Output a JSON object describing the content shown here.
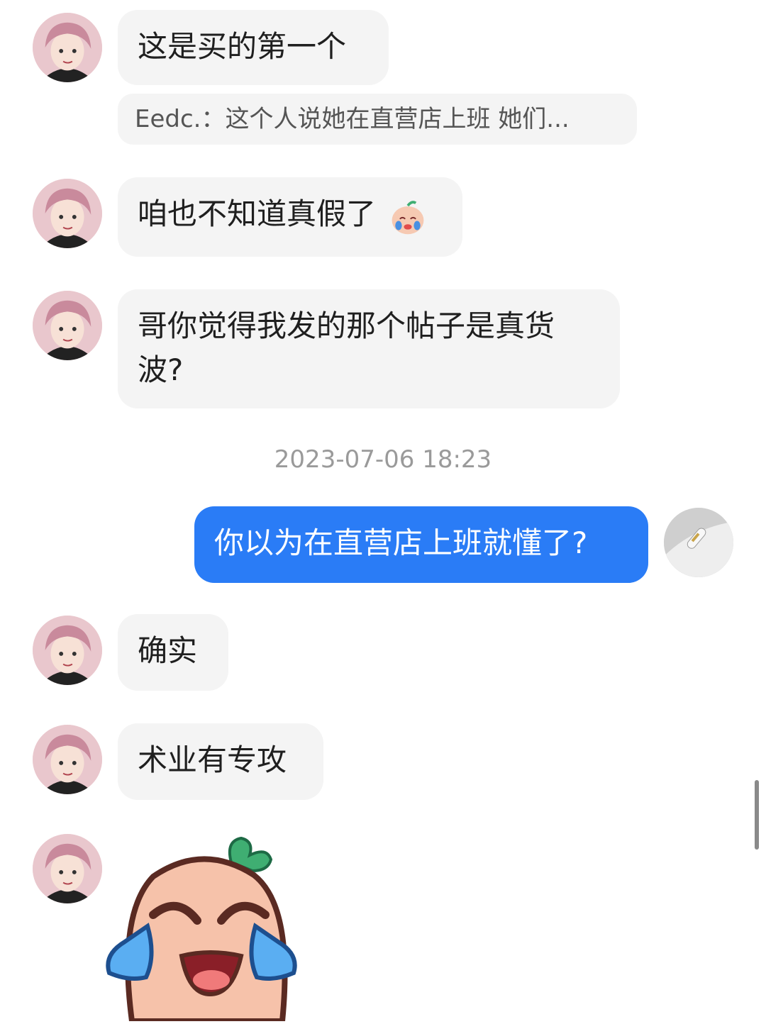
{
  "messages": [
    {
      "sender": "other",
      "text": "这是买的第一个"
    },
    {
      "sender": "other",
      "type": "quote",
      "text": "Eedc.：这个人说她在直营店上班 她们..."
    },
    {
      "sender": "other",
      "text": "咱也不知道真假了",
      "emoji": "crying-peach-emoji"
    },
    {
      "sender": "other",
      "text": "哥你觉得我发的那个帖子是真货波?"
    },
    {
      "sender": "self",
      "text": "你以为在直营店上班就懂了?"
    },
    {
      "sender": "other",
      "text": "确实"
    },
    {
      "sender": "other",
      "text": "术业有专攻"
    },
    {
      "sender": "other",
      "type": "sticker",
      "sticker": "crying-peach-sticker"
    }
  ],
  "timestamp": "2023-07-06 18:23",
  "colors": {
    "self_bubble": "#2a7cf6",
    "other_bubble": "#f4f4f4",
    "timestamp_text": "#9a9a9a"
  },
  "icons": {
    "other_avatar": "anime-girl-avatar",
    "self_avatar": "cable-photo-avatar"
  }
}
